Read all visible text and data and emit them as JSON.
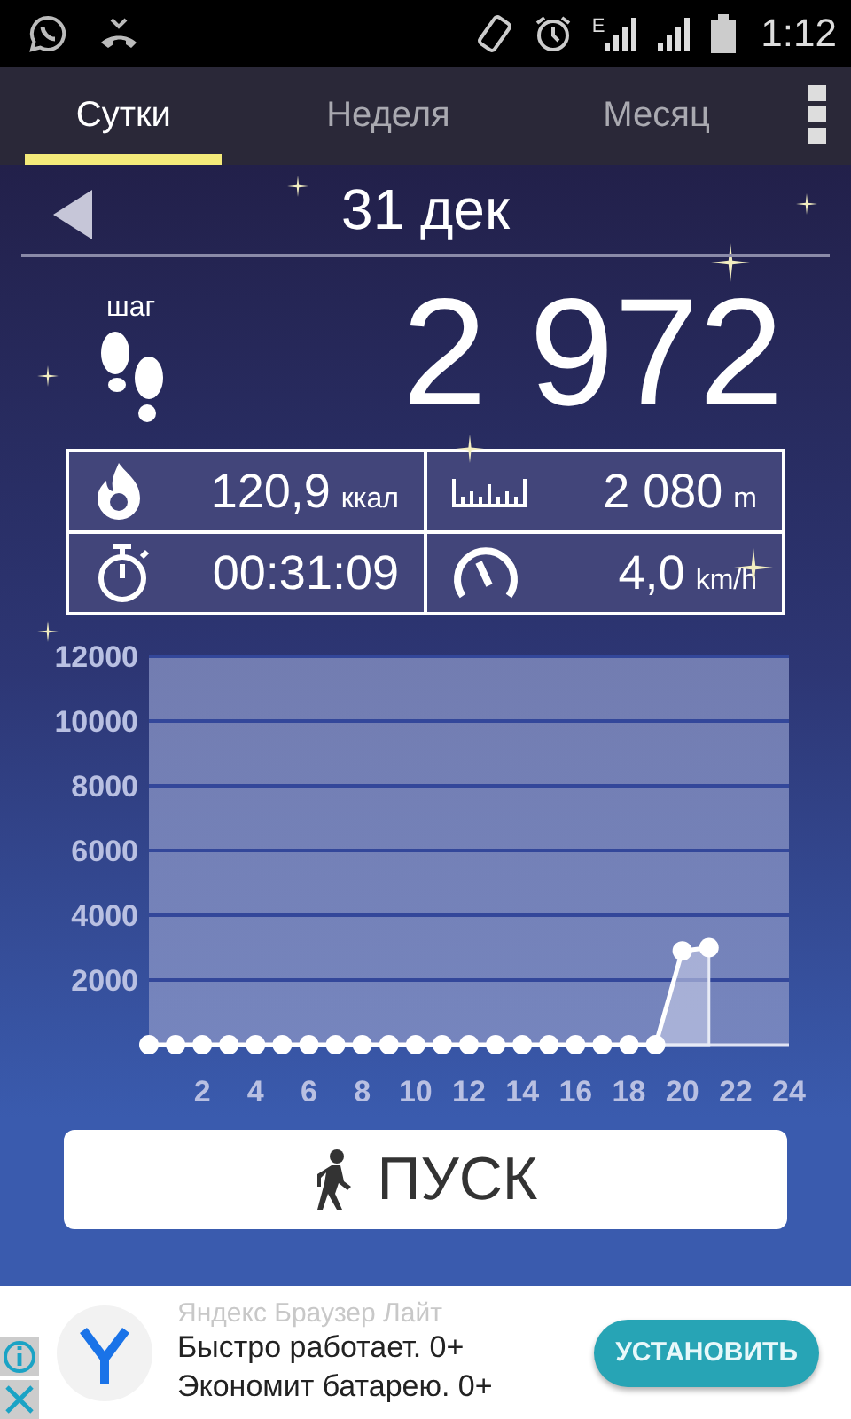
{
  "status_bar": {
    "network_label": "E",
    "time": "1:12"
  },
  "tabs": [
    {
      "label": "Сутки",
      "selected": true
    },
    {
      "label": "Неделя",
      "selected": false
    },
    {
      "label": "Месяц",
      "selected": false
    }
  ],
  "date": "31 дек",
  "steps": {
    "label": "шаг",
    "value": "2 972"
  },
  "stats": [
    {
      "kind": "calories",
      "value": "120,9",
      "unit": "ккал"
    },
    {
      "kind": "distance",
      "value": "2 080",
      "unit": "m"
    },
    {
      "kind": "duration",
      "value": "00:31:09"
    },
    {
      "kind": "speed",
      "value": "4,0",
      "unit": "km/h"
    }
  ],
  "chart_data": {
    "type": "line",
    "x": [
      0,
      1,
      2,
      3,
      4,
      5,
      6,
      7,
      8,
      9,
      10,
      11,
      12,
      13,
      14,
      15,
      16,
      17,
      18,
      19,
      20,
      21
    ],
    "grid": true,
    "series": [
      {
        "color": "#ffffff",
        "marker": true,
        "values": [
          0,
          0,
          0,
          0,
          0,
          0,
          0,
          0,
          0,
          0,
          0,
          0,
          0,
          0,
          0,
          0,
          0,
          0,
          0,
          0,
          2900,
          3000
        ]
      }
    ],
    "xlim": [
      0,
      24
    ],
    "ylim": [
      0,
      12000
    ],
    "xticks": [
      2,
      4,
      6,
      8,
      10,
      12,
      14,
      16,
      18,
      20,
      22,
      24
    ],
    "yticks": [
      2000,
      4000,
      6000,
      8000,
      10000,
      12000
    ]
  },
  "start_button": {
    "label": "ПУСК"
  },
  "ad": {
    "title": "Яндекс Браузер Лайт",
    "lines": [
      "Быстро работает. 0+",
      "Экономит батарею. 0+"
    ],
    "button": "УСТАНОВИТЬ"
  }
}
